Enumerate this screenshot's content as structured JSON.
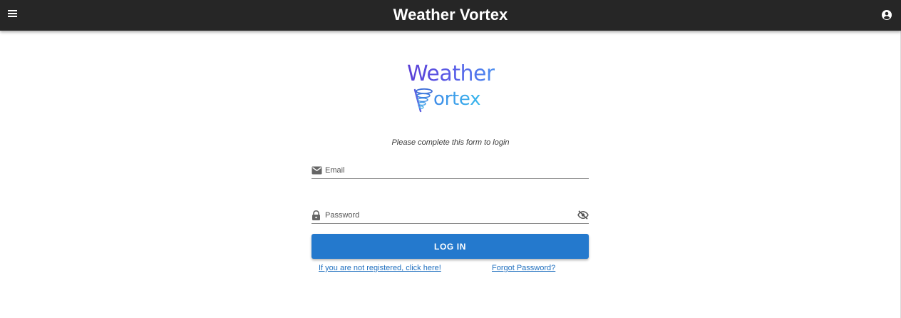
{
  "header": {
    "title": "Weather Vortex",
    "menu_icon": "hamburger-menu-icon",
    "account_icon": "account-circle-icon",
    "background": "#262626"
  },
  "logo": {
    "line1": "Weather",
    "line2": "ortex",
    "icon": "tornado-icon"
  },
  "form": {
    "instruction": "Please complete this form to login",
    "email": {
      "placeholder": "Email",
      "value": "",
      "icon": "mail-icon"
    },
    "password": {
      "placeholder": "Password",
      "value": "",
      "icon": "lock-icon",
      "toggle_icon": "eye-off-icon"
    },
    "login_label": "LOG IN",
    "register_link": "If you are not registered, click here!",
    "forgot_link": "Forgot Password?"
  },
  "colors": {
    "primary_button": "#2479cd",
    "link": "#1f6fbf"
  }
}
